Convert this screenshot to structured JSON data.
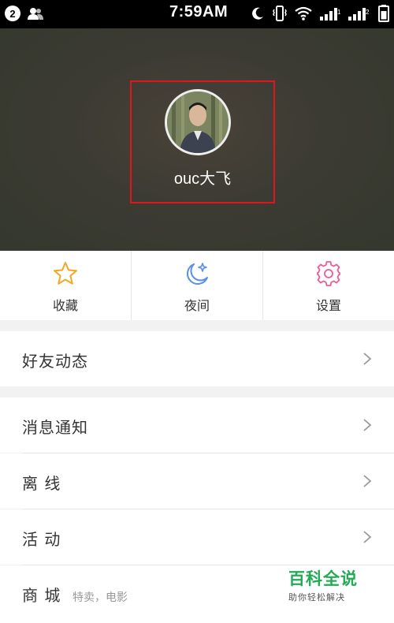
{
  "status_bar": {
    "notification_count": "2",
    "time": "7:59AM",
    "icons": [
      "user-icon",
      "moon-icon",
      "vibrate-icon",
      "wifi-icon",
      "signal-icon",
      "signal2-icon",
      "battery-icon"
    ]
  },
  "profile": {
    "username": "ouc大飞",
    "highlight_color": "#e0161e"
  },
  "quick_actions": [
    {
      "label": "收藏",
      "icon": "star-icon",
      "color": "#f5a623"
    },
    {
      "label": "夜间",
      "icon": "moon-star-icon",
      "color": "#5b8fe8"
    },
    {
      "label": "设置",
      "icon": "gear-icon",
      "color": "#e85d9a"
    }
  ],
  "menu": {
    "friends": {
      "label": "好友动态"
    },
    "messages": {
      "label": "消息通知"
    },
    "offline": {
      "label": "离 线"
    },
    "activity": {
      "label": "活 动"
    },
    "mall": {
      "label": "商 城",
      "sub": "特卖，电影"
    }
  },
  "watermark": {
    "title": "百科全说",
    "subtitle": "助你轻松解决"
  }
}
